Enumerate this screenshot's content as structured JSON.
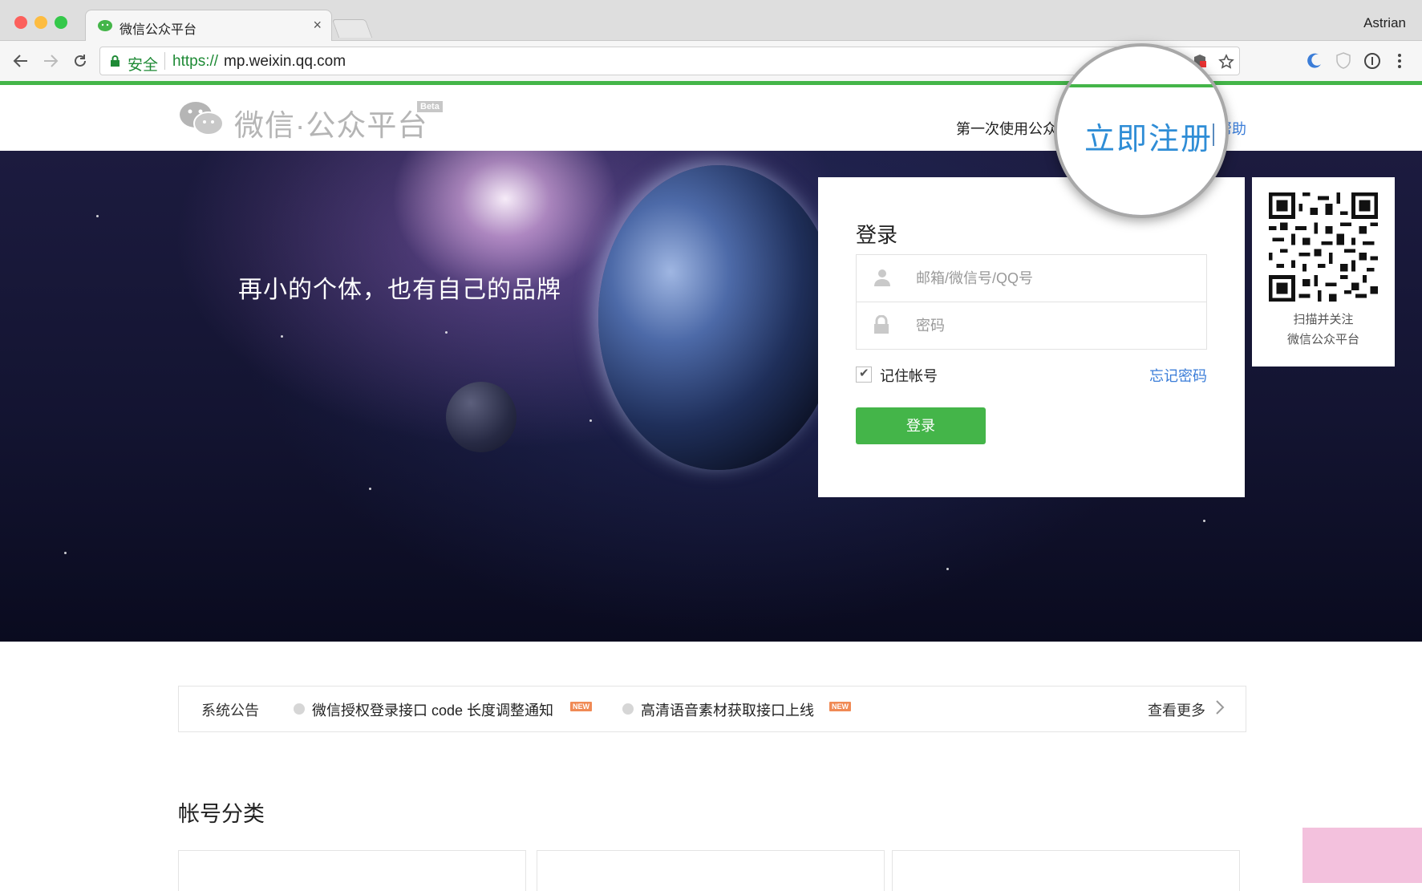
{
  "browser": {
    "tab_title": "微信公众平台",
    "tab_close": "×",
    "profile_name": "Astrian",
    "secure_label": "安全",
    "url_scheme": "https://",
    "url_host": "mp.weixin.qq.com"
  },
  "header": {
    "logo_text": "微信·公众平台",
    "beta_label": "Beta",
    "first_use_text": "第一次使用公众",
    "help_link": "帮助"
  },
  "magnifier": {
    "register_link": "立即注册"
  },
  "hero": {
    "slogan": "再小的个体，也有自己的品牌"
  },
  "login": {
    "title": "登录",
    "account_placeholder": "邮箱/微信号/QQ号",
    "password_placeholder": "密码",
    "remember_label": "记住帐号",
    "remember_checked": true,
    "forgot_link": "忘记密码",
    "submit_label": "登录"
  },
  "qr": {
    "caption_line1": "扫描并关注",
    "caption_line2": "微信公众平台"
  },
  "notices": {
    "label": "系统公告",
    "items": [
      {
        "text": "微信授权登录接口 code 长度调整通知",
        "badge": "NEW"
      },
      {
        "text": "高清语音素材获取接口上线",
        "badge": "NEW"
      }
    ],
    "more_label": "查看更多"
  },
  "account_section": {
    "title": "帐号分类"
  },
  "colors": {
    "brand_green": "#44b549",
    "link_blue": "#3b7dd8",
    "register_blue": "#2f8dd6",
    "badge_orange": "#f08a55"
  }
}
